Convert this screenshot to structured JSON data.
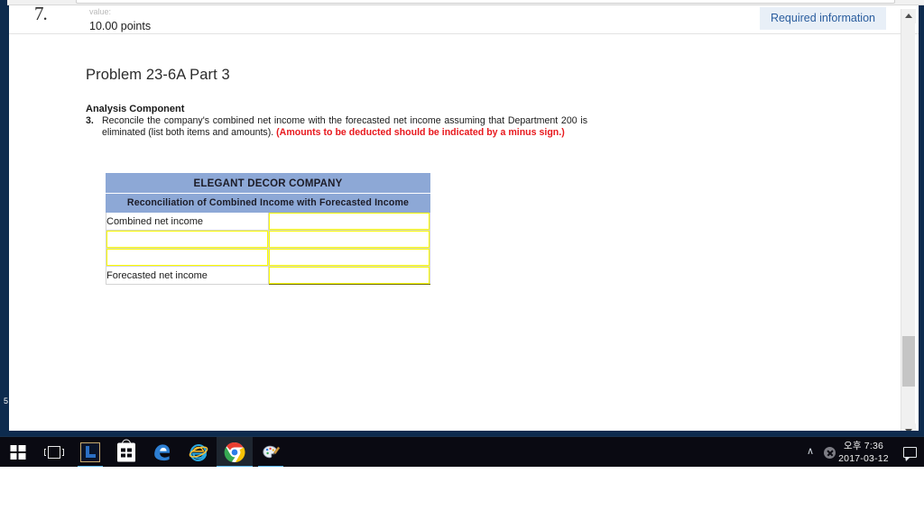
{
  "question": {
    "number": "7.",
    "value_label": "value:",
    "points": "10.00 points",
    "required_badge": "Required information"
  },
  "problem": {
    "title": "Problem 23-6A Part 3",
    "analysis_heading": "Analysis Component",
    "item_number": "3.",
    "instruction_plain": "Reconcile the company's combined net income with the forecasted net income assuming that Department 200 is eliminated (list both items and amounts).",
    "instruction_highlight": "(Amounts to be deducted should be indicated by a minus sign.)"
  },
  "worksheet": {
    "company_name": "ELEGANT DECOR COMPANY",
    "statement_title": "Reconciliation of Combined Income with Forecasted Income",
    "header_bg": "#8da8d6",
    "input_border": "#ffff00",
    "rows": [
      {
        "label": "Combined net income",
        "label_editable": false,
        "amount": "",
        "amount_editable": true,
        "subtotal_rule": false
      },
      {
        "label": "",
        "label_editable": true,
        "amount": "",
        "amount_editable": true,
        "subtotal_rule": false
      },
      {
        "label": "",
        "label_editable": true,
        "amount": "",
        "amount_editable": true,
        "subtotal_rule": false
      },
      {
        "label": "Forecasted net income",
        "label_editable": false,
        "amount": "",
        "amount_editable": true,
        "subtotal_rule": true
      }
    ]
  },
  "stray_glyph": "5",
  "scrollbar": {
    "up_arrow": "▲",
    "down_arrow": "▼"
  },
  "taskbar": {
    "items": [
      {
        "name": "start-button",
        "label": "Start",
        "state": "idle"
      },
      {
        "name": "task-view-button",
        "label": "Task View",
        "state": "idle"
      },
      {
        "name": "league-of-legends",
        "label": "League of Legends",
        "state": "running"
      },
      {
        "name": "microsoft-store",
        "label": "Microsoft Store",
        "state": "idle"
      },
      {
        "name": "microsoft-edge",
        "label": "Microsoft Edge",
        "state": "idle"
      },
      {
        "name": "internet-explorer",
        "label": "Internet Explorer",
        "state": "idle"
      },
      {
        "name": "google-chrome",
        "label": "Google Chrome",
        "state": "active"
      },
      {
        "name": "paint-3d",
        "label": "Paint 3D",
        "state": "running"
      }
    ],
    "tray": {
      "chevron": "∧",
      "security_icon": "security-shield-icon",
      "time": "오후 7:36",
      "date": "2017-03-12",
      "action_center": "action-center-icon"
    }
  }
}
